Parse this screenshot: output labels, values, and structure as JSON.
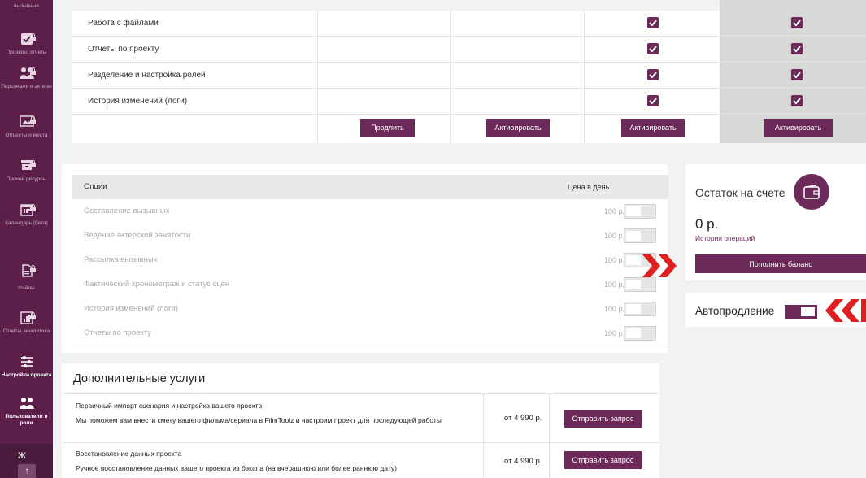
{
  "sidebar": {
    "top_label": "вызывные",
    "items": [
      {
        "label": "Прозвон, отчеты",
        "icon": "check-icon"
      },
      {
        "label": "Персонажи и актеры",
        "icon": "people-icon"
      },
      {
        "label": "Объекты и места",
        "icon": "picture-icon"
      },
      {
        "label": "Прочие ресурсы",
        "icon": "box-icon"
      },
      {
        "label": "Календарь (бета)",
        "icon": "calendar-icon"
      },
      {
        "label": "Файлы",
        "icon": "file-icon"
      },
      {
        "label": "Отчеты, аналитика",
        "icon": "chart-icon"
      },
      {
        "label": "Настройки проекта",
        "icon": "sliders-icon"
      },
      {
        "label": "Пользователи и роли",
        "icon": "users-icon"
      }
    ],
    "bottom_letter": "Ж",
    "scroll_up_glyph": "↑"
  },
  "plans": {
    "features": [
      "Работа с файлами",
      "Отчеты по проекту",
      "Разделение и настройка ролей",
      "История изменений (логи)"
    ],
    "buttons": [
      "Продлить",
      "Активировать",
      "Активировать",
      "Активировать"
    ]
  },
  "options": {
    "header_title": "Опции",
    "header_price": "Цена в день",
    "rows": [
      {
        "name": "Составление вызывных",
        "price": "100 р."
      },
      {
        "name": "Ведение актерской занятости",
        "price": "100 р."
      },
      {
        "name": "Рассылка вызывных",
        "price": "100 р."
      },
      {
        "name": "Фактический хронометраж и статус сцен",
        "price": "100 р."
      },
      {
        "name": "История изменений (логи)",
        "price": "100 р."
      },
      {
        "name": "Отчеты по проекту",
        "price": "100 р."
      }
    ]
  },
  "balance": {
    "title": "Остаток на счете",
    "amount": "0 р.",
    "history_link": "История операций",
    "topup_button": "Пополнить баланс",
    "autorenew_label": "Автопродление"
  },
  "services": {
    "title": "Дополнительные услуги",
    "items": [
      {
        "name": "Первичный импорт сценария и настройка вашего проекта",
        "desc": "Мы поможем вам внести смету вашего фильма/сериала в FilmToolz и настроим проект для последующей работы",
        "price": "от 4 990 р.",
        "button": "Отправить запрос"
      },
      {
        "name": "Восстановление данных проекта",
        "desc": "Ручное восстановление данных вашего проекта из бэкапа (на вчерашнюю или более раннюю дату)",
        "price": "от 4 990 р.",
        "button": "Отправить запрос"
      }
    ]
  },
  "colors": {
    "accent": "#6b2a5a",
    "sidebar": "#5b1f4a",
    "highlight_arrow": "#e02020"
  }
}
